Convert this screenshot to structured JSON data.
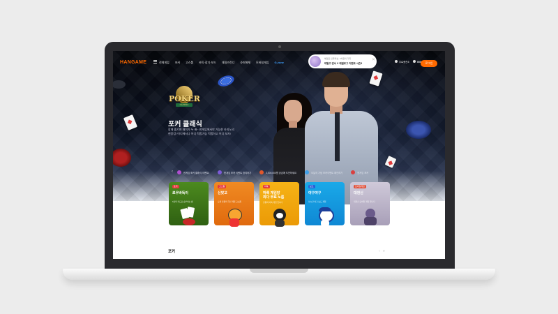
{
  "site": {
    "logo": "HANGAME",
    "colors": {
      "brand": "#ff6a00",
      "gzone": "#3fa0ff",
      "badge_red": "#e5373b"
    }
  },
  "nav": {
    "menu_icon": "hamburger-icon",
    "all_games": "전체게임",
    "items": [
      "포커",
      "고스톱",
      "바둑·장기·보드",
      "데일즈런너",
      "슈퍼해체",
      "모바일게임"
    ],
    "gzone": "G-zone"
  },
  "promo": {
    "line1": "헤일로 인플레션, 4차원의 기회",
    "line2": "데일즈 런너 X 에필로그 이벤트 시즌3",
    "close_icon": "close-icon"
  },
  "utility": {
    "items": [
      "무료충전소",
      "INSIDE WHIN"
    ],
    "login": "로그인"
  },
  "hero": {
    "logo_text": "POKER",
    "logo_sub": "CLASSIC",
    "title": "포커 클래식",
    "desc_line1": "함께 즐기면 재미가 두 배~ 한게임에서만 가능한 카지노의",
    "desc_line2": "현장감! 어디에서나 어디 적합가능 적합하고 어디 보자!"
  },
  "notices": [
    {
      "text": "한게임 포커 클래식 이벤트!",
      "color": "#b04fd0"
    },
    {
      "text": "한게임 포커 이벤트 참여하기",
      "color": "#7d5bd8"
    },
    {
      "text": "2,000,000원 상금에 도전하세요",
      "color": "#e2572b"
    },
    {
      "text": "오늘의 기념 포커이벤트 확인하기",
      "color": "#3fa0e8"
    },
    {
      "text": "한게임 포커",
      "color": "#d94040"
    }
  ],
  "games": [
    {
      "tag": "포커",
      "name": "로우바둑이",
      "desc": "6장의 카드로 승부하는 룰",
      "bg": "#4c8a1e",
      "bg2": "#2f6012"
    },
    {
      "tag": "고스톱",
      "name": "신맞고",
      "desc": "오랜 전통의 국민 게임 고스톱",
      "bg": "#f08a22",
      "bg2": "#e06a0e"
    },
    {
      "tag": "바둑",
      "name": "하록 게임방\n최다 무료 노름",
      "desc": "전통의 바둑 게임 입니다",
      "bg": "#f6b316",
      "bg2": "#eb9a06"
    },
    {
      "tag": "보드",
      "name": "야구야구",
      "desc": "실시간 야구 보드 게임",
      "bg": "#1aa9e8",
      "bg2": "#0f88d4"
    },
    {
      "tag": "모바일게임",
      "name": "대천신",
      "desc": "대천신 모바일 게임 입니다",
      "bg": "#cfc9d9",
      "bg2": "#a89fb8"
    }
  ],
  "section": {
    "title": "포커",
    "prev_icon": "chevron-left-icon",
    "next_icon": "chevron-right-icon"
  }
}
